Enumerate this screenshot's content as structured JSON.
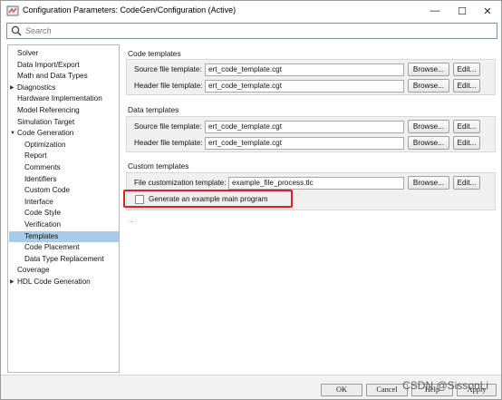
{
  "window": {
    "title": "Configuration Parameters: CodeGen/Configuration (Active)",
    "minimize": "—",
    "maximize": "☐",
    "close": "✕"
  },
  "search": {
    "placeholder": "Search"
  },
  "tree": {
    "items": [
      {
        "label": "Solver",
        "level": 0
      },
      {
        "label": "Data Import/Export",
        "level": 0
      },
      {
        "label": "Math and Data Types",
        "level": 0
      },
      {
        "label": "Diagnostics",
        "level": 0,
        "arrow": "▶"
      },
      {
        "label": "Hardware Implementation",
        "level": 0
      },
      {
        "label": "Model Referencing",
        "level": 0
      },
      {
        "label": "Simulation Target",
        "level": 0
      },
      {
        "label": "Code Generation",
        "level": 0,
        "arrow": "▼"
      },
      {
        "label": "Optimization",
        "level": 1
      },
      {
        "label": "Report",
        "level": 1
      },
      {
        "label": "Comments",
        "level": 1
      },
      {
        "label": "Identifiers",
        "level": 1
      },
      {
        "label": "Custom Code",
        "level": 1
      },
      {
        "label": "Interface",
        "level": 1
      },
      {
        "label": "Code Style",
        "level": 1
      },
      {
        "label": "Verification",
        "level": 1
      },
      {
        "label": "Templates",
        "level": 1,
        "selected": true
      },
      {
        "label": "Code Placement",
        "level": 1
      },
      {
        "label": "Data Type Replacement",
        "level": 1
      },
      {
        "label": "Coverage",
        "level": 0
      },
      {
        "label": "HDL Code Generation",
        "level": 0,
        "arrow": "▶"
      }
    ]
  },
  "code_templates": {
    "title": "Code templates",
    "source_label": "Source file template:",
    "source_value": "ert_code_template.cgt",
    "header_label": "Header file template:",
    "header_value": "ert_code_template.cgt"
  },
  "data_templates": {
    "title": "Data templates",
    "source_label": "Source file template:",
    "source_value": "ert_code_template.cgt",
    "header_label": "Header file template:",
    "header_value": "ert_code_template.cgt"
  },
  "custom_templates": {
    "title": "Custom templates",
    "file_label": "File customization template:",
    "file_value": "example_file_process.tlc",
    "checkbox_label": "Generate an example main program",
    "checkbox_checked": false
  },
  "buttons": {
    "browse": "Browse...",
    "edit": "Edit..."
  },
  "ellipsis": "...",
  "bottom": {
    "ok": "OK",
    "cancel": "Cancel",
    "help": "Help",
    "apply": "Apply"
  },
  "watermark": "CSDN @SissonLi",
  "colors": {
    "selection": "#a9cbe9",
    "highlight": "#e02020"
  }
}
